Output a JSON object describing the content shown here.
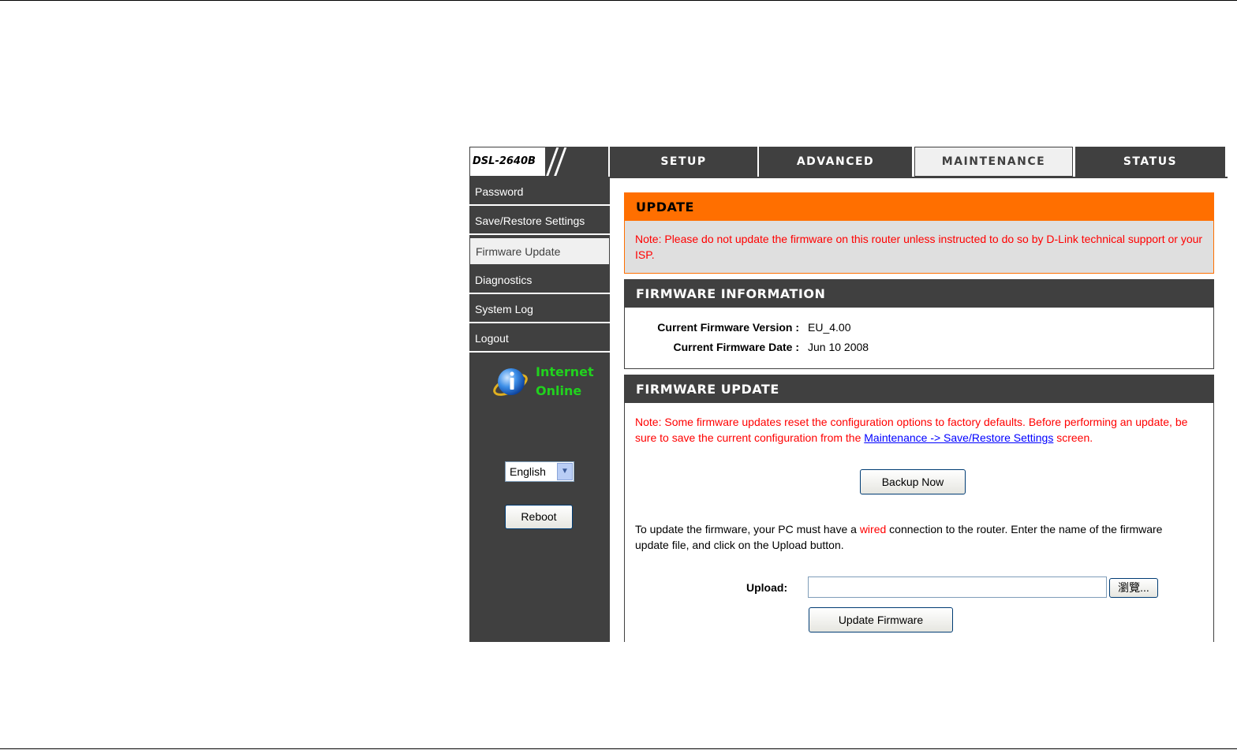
{
  "logo": {
    "model": "DSL-2640B"
  },
  "tabs": [
    {
      "label": "SETUP"
    },
    {
      "label": "ADVANCED"
    },
    {
      "label": "MAINTENANCE"
    },
    {
      "label": "STATUS"
    }
  ],
  "active_tab": "MAINTENANCE",
  "sidebar": {
    "items": [
      {
        "label": "Password"
      },
      {
        "label": "Save/Restore Settings"
      },
      {
        "label": "Firmware Update"
      },
      {
        "label": "Diagnostics"
      },
      {
        "label": "System Log"
      },
      {
        "label": "Logout"
      }
    ],
    "active_item": "Firmware Update",
    "status": {
      "line1": "Internet",
      "line2": "Online",
      "color": "#21d21e"
    },
    "language": {
      "selected": "English"
    },
    "reboot_label": "Reboot"
  },
  "update_box": {
    "title": "UPDATE",
    "note": "Note: Please do not update the firmware on this router unless instructed to do so by D-Link technical support or your ISP."
  },
  "firmware_info": {
    "title": "FIRMWARE INFORMATION",
    "version_label": "Current Firmware Version :",
    "version_value": "EU_4.00",
    "date_label": "Current Firmware Date :",
    "date_value": "Jun 10 2008"
  },
  "firmware_update": {
    "title": "FIRMWARE UPDATE",
    "note_prefix": "Note: Some firmware updates reset the configuration options to factory defaults. Before performing an update, be sure to save the current configuration from the ",
    "note_link": "Maintenance -> Save/Restore Settings",
    "note_suffix": " screen.",
    "backup_label": "Backup Now",
    "instructions_prefix": "To update the firmware, your PC must have a ",
    "instructions_highlight": "wired",
    "instructions_suffix": " connection to the router. Enter the name of the firmware update file, and click on the Upload button.",
    "upload_label": "Upload:",
    "upload_value": "",
    "browse_label": "瀏覽...",
    "update_label": "Update Firmware"
  },
  "colors": {
    "header_dark": "#404040",
    "accent_orange": "#ff6f00",
    "note_red": "#ff0000",
    "link_blue": "#0000ff"
  }
}
